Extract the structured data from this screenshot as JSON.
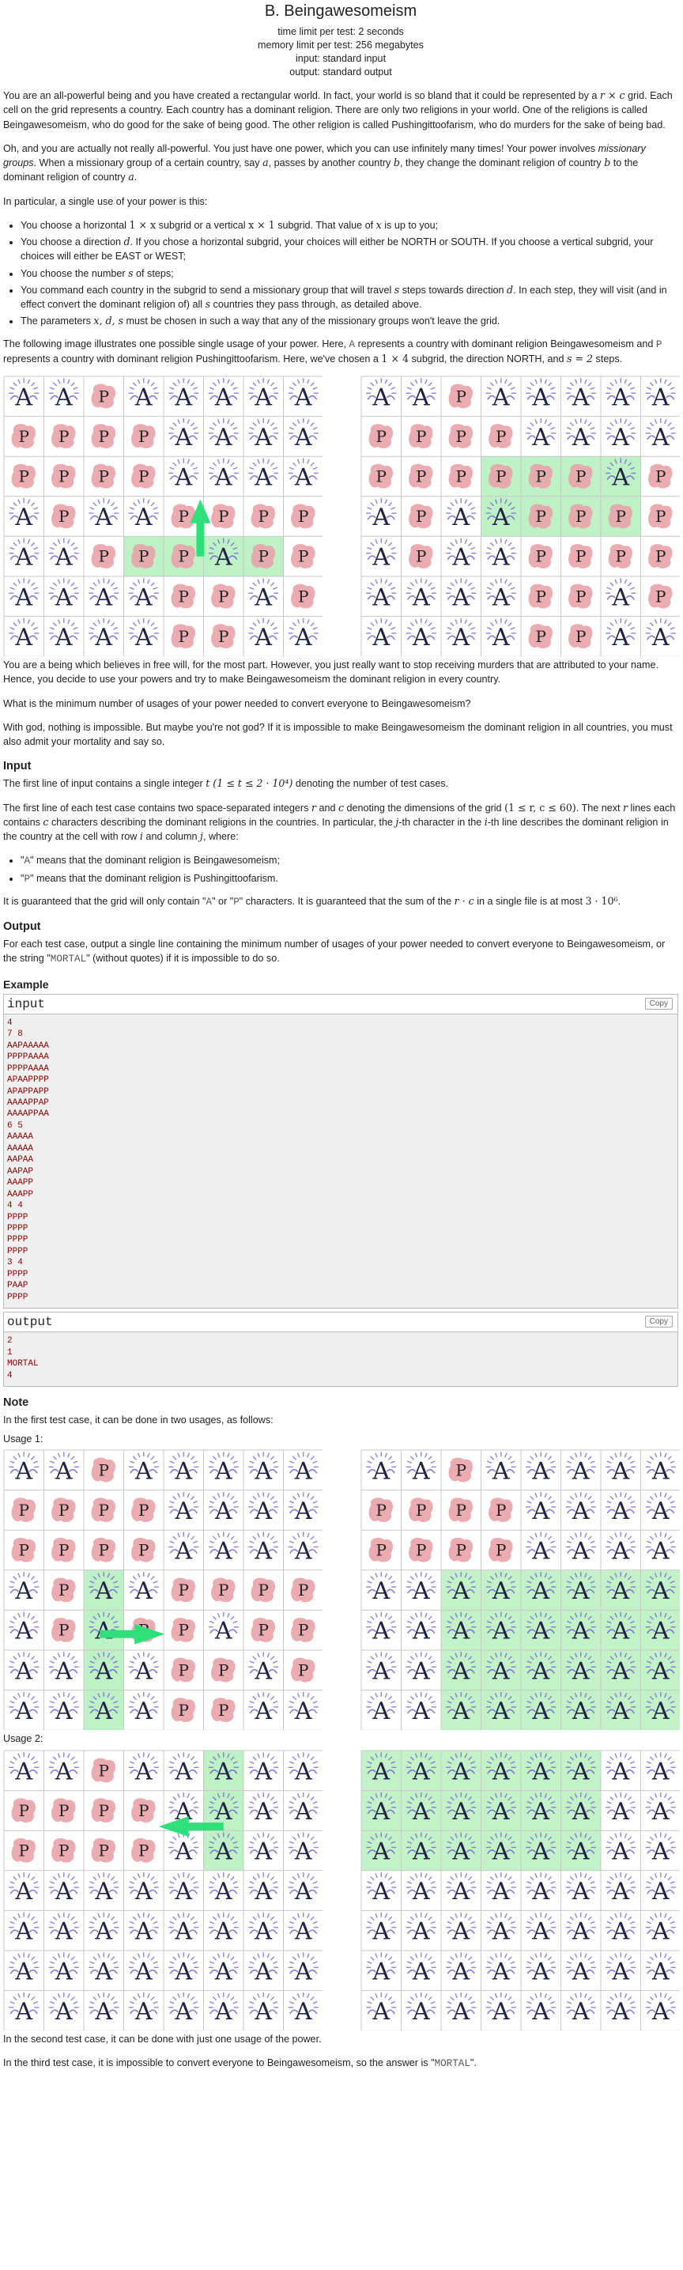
{
  "header": {
    "title": "B. Beingawesomeism",
    "time_limit": "time limit per test: 2 seconds",
    "memory_limit": "memory limit per test: 256 megabytes",
    "input": "input: standard input",
    "output": "output: standard output"
  },
  "legend": {
    "cell_a": "A",
    "cell_p": "P"
  },
  "statement": {
    "p1a": "You are an all-powerful being and you have created a rectangular world. In fact, your world is so bland that it could be represented by a ",
    "p1b": " grid. Each cell on the grid represents a country. Each country has a dominant religion. There are only two religions in your world. One of the religions is called Beingawesomeism, who do good for the sake of being good. The other religion is called Pushingittoofarism, who do murders for the sake of being bad.",
    "p2a": "Oh, and you are actually not really all-powerful. You just have one power, which you can use infinitely many times! Your power involves ",
    "p2em": "missionary groups",
    "p2b": ". When a missionary group of a certain country, say ",
    "p2c": ", passes by another country ",
    "p2d": ", they change the dominant religion of country ",
    "p2e": " to the dominant religion of country ",
    "p2f": ".",
    "p3": "In particular, a single use of your power is this:",
    "li1a": "You choose a horizontal ",
    "li1b": " subgrid or a vertical ",
    "li1c": " subgrid. That value of ",
    "li1d": " is up to you;",
    "li2a": "You choose a direction ",
    "li2b": ". If you chose a horizontal subgrid, your choices will either be NORTH or SOUTH. If you choose a vertical subgrid, your choices will either be EAST or WEST;",
    "li3a": "You choose the number ",
    "li3b": " of steps;",
    "li4a": "You command each country in the subgrid to send a missionary group that will travel ",
    "li4b": " steps towards direction ",
    "li4c": ". In each step, they will visit (and in effect convert the dominant religion of) all ",
    "li4d": " countries they pass through, as detailed above.",
    "li5a": "The parameters ",
    "li5b": " must be chosen in such a way that any of the missionary groups won't leave the grid.",
    "p4a": "The following image illustrates one possible single usage of your power. Here, ",
    "p4b": " represents a country with dominant religion Beingawesomeism and ",
    "p4c": " represents a country with dominant religion Pushingittoofarism. Here, we've chosen a ",
    "p4d": " subgrid, the direction NORTH, and ",
    "p4e": " steps.",
    "p5": "You are a being which believes in free will, for the most part. However, you just really want to stop receiving murders that are attributed to your name. Hence, you decide to use your powers and try to make Beingawesomeism the dominant religion in every country.",
    "p6": "What is the minimum number of usages of your power needed to convert everyone to Beingawesomeism?",
    "p7": "With god, nothing is impossible. But maybe you're not god? If it is impossible to make Beingawesomeism the dominant religion in all countries, you must also admit your mortality and say so."
  },
  "math": {
    "r": "r",
    "c": "c",
    "x": "x",
    "d": "d",
    "s": "s",
    "a": "a",
    "b": "b",
    "times": " × ",
    "one": "1",
    "xds": "x, d, s",
    "one_by_x": "1 × x",
    "x_by_one": "x × 1",
    "one_by_four": "1 × 4",
    "s_eq_2": "s = 2",
    "t_range": "t (1 ≤ t ≤ 2 · 10⁴)",
    "rc_range": "(1 ≤ r, c ≤ 60)",
    "j": "j",
    "i": "i",
    "r_dot_c": "r · c",
    "limit": "3 · 10⁶"
  },
  "input_section": {
    "heading": "Input",
    "p1a": "The first line of input contains a single integer ",
    "p1b": " denoting the number of test cases.",
    "p2a": "The first line of each test case contains two space-separated integers ",
    "p2b": " and ",
    "p2c": " denoting the dimensions of the grid ",
    "p2d": ". The next ",
    "p2e": " lines each contains ",
    "p2f": " characters describing the dominant religions in the countries. In particular, the ",
    "p2g": "-th character in the ",
    "p2h": "-th line describes the dominant religion in the country at the cell with row ",
    "p2i": " and column ",
    "p2j": ", where:",
    "li1a": "\"",
    "li1code": "A",
    "li1b": "\" means that the dominant religion is Beingawesomeism;",
    "li2a": "\"",
    "li2code": "P",
    "li2b": "\" means that the dominant religion is Pushingittoofarism.",
    "p3a": "It is guaranteed that the grid will only contain \"",
    "p3b": "\" or \"",
    "p3c": "\" characters. It is guaranteed that the sum of the ",
    "p3d": " in a single file is at most ",
    "p3e": "."
  },
  "output_section": {
    "heading": "Output",
    "p1a": "For each test case, output a single line containing the minimum number of usages of your power needed to convert everyone to Beingawesomeism, or the string \"",
    "p1code": "MORTAL",
    "p1b": "\" (without quotes) if it is impossible to do so."
  },
  "example": {
    "heading": "Example",
    "input_label": "input",
    "output_label": "output",
    "copy_label": "Copy",
    "input_text": "4\n7 8\nAAPAAAAA\nPPPPAAAA\nPPPPAAAA\nAPAAPPPP\nAPAPPAPP\nAAAAPPAP\nAAAAPPAA\n6 5\nAAAAA\nAAAAA\nAAPAA\nAAPAP\nAAAPP\nAAAPP\n4 4\nPPPP\nPPPP\nPPPP\nPPPP\n3 4\nPPPP\nPAAP\nPPPP",
    "output_text": "2\n1\nMORTAL\n4"
  },
  "note": {
    "heading": "Note",
    "p1": "In the first test case, it can be done in two usages, as follows:",
    "usage1": "Usage 1:",
    "usage2": "Usage 2:",
    "p2": "In the second test case, it can be done with just one usage of the power.",
    "p3a": "In the third test case, it is impossible to convert everyone to Beingawesomeism, so the answer is \"",
    "p3code": "MORTAL",
    "p3b": "\"."
  },
  "colors": {
    "a_letter": "#222244",
    "a_halo": "#6a5acd",
    "p_blob": "#e8a3a8",
    "p_letter": "#222222",
    "highlight": "#b8f0c0",
    "arrow": "#2fe07a"
  },
  "figures": {
    "fig1_before": {
      "rows": [
        "AAPAAAAA",
        "PPPPAAAA",
        "PPPPAAAA",
        "APAAPPPP",
        "AAPPPAPP",
        "AAAAPPAP",
        "AAAAPPAA"
      ],
      "highlight_row": 4,
      "highlight_col": 3,
      "highlight_len": 4,
      "arrow": "north",
      "arrow_anchor_col": 4.9
    },
    "fig1_after": {
      "rows": [
        "AAPAAAAA",
        "PPPPAAAA",
        "PPPPPPAP",
        "APAAPPPP",
        "APAAPPPP",
        "AAAAPPAP",
        "AAAAPPAA"
      ],
      "highlight_row": 2,
      "highlight_col": 3,
      "highlight_len": 4,
      "highlight2_row": 3,
      "highlight2_col": 3,
      "highlight2_len": 4
    },
    "note1_before": {
      "rows": [
        "AAPAAAAA",
        "PPPPAAAA",
        "PPPPAAAA",
        "APAAPPPP",
        "APAPPAPP",
        "AAAAPPAP",
        "AAAAPPAA"
      ],
      "vhighlight_col": 2,
      "vhighlight_row": 3,
      "vhighlight_len": 4,
      "arrow": "east"
    },
    "note1_after": {
      "rows": [
        "AAPAAAAA",
        "PPPPAAAA",
        "PPPPAAAA",
        "AAAAAAAA",
        "AAAAAAAA",
        "AAAAAAAA",
        "AAAAAAAA"
      ],
      "fill_from_col": 2,
      "fill_from_row": 3,
      "fill_to_row": 7
    },
    "note2_before": {
      "rows": [
        "AAPAAAAA",
        "PPPPAAAA",
        "PPPPAAAA",
        "AAAAAAAA",
        "AAAAAAAA",
        "AAAAAAAA",
        "AAAAAAAA"
      ],
      "vhighlight_col": 5,
      "vhighlight_row": 0,
      "vhighlight_len": 3,
      "arrow": "west"
    },
    "note2_after": {
      "rows": [
        "AAAAAAAA",
        "AAAAAAAA",
        "AAAAAAAA",
        "AAAAAAAA",
        "AAAAAAAA",
        "AAAAAAAA",
        "AAAAAAAA"
      ],
      "fill_from_col": 0,
      "fill_to_col": 6,
      "fill_from_row": 0,
      "fill_to_row": 3
    }
  }
}
